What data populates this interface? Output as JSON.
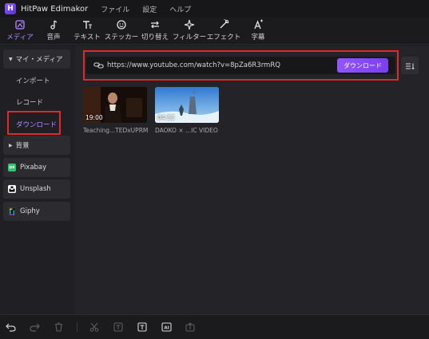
{
  "app": {
    "title": "HitPaw Edimakor",
    "logo_letter": "H"
  },
  "menu": [
    "ファイル",
    "設定",
    "ヘルプ"
  ],
  "toolbar": [
    {
      "label": "メディア",
      "icon": "media-icon",
      "active": true
    },
    {
      "label": "音声",
      "icon": "audio-icon",
      "active": false
    },
    {
      "label": "テキスト",
      "icon": "text-icon",
      "active": false
    },
    {
      "label": "ステッカー",
      "icon": "sticker-icon",
      "active": false
    },
    {
      "label": "切り替え",
      "icon": "transition-icon",
      "active": false
    },
    {
      "label": "フィルター",
      "icon": "filter-icon",
      "active": false
    },
    {
      "label": "エフェクト",
      "icon": "effect-icon",
      "active": false
    },
    {
      "label": "字幕",
      "icon": "subtitle-icon",
      "active": false
    }
  ],
  "sidebar": {
    "my_media": "マイ・メディア",
    "items": [
      "インポート",
      "レコード",
      "ダウンロード"
    ],
    "active_item": "ダウンロード",
    "background": "背景",
    "sources": [
      {
        "label": "Pixabay",
        "icon": "pixabay-icon",
        "badge": "px",
        "color": "#2ec66d"
      },
      {
        "label": "Unsplash",
        "icon": "unsplash-icon",
        "badge": "",
        "color": "#ffffff"
      },
      {
        "label": "Giphy",
        "icon": "giphy-icon",
        "badge": "",
        "color": "#111111"
      }
    ]
  },
  "download": {
    "url": "https://www.youtube.com/watch?v=8pZa6R3rmRQ",
    "button_label": "ダウンロード"
  },
  "media": [
    {
      "caption": "Teaching...TEDxUPRM",
      "duration": "19:00"
    },
    {
      "caption": "DAOKO × ...IC VIDEO",
      "duration": "04:52"
    }
  ],
  "colors": {
    "accent": "#9255ff",
    "highlight": "#e02a2a"
  }
}
